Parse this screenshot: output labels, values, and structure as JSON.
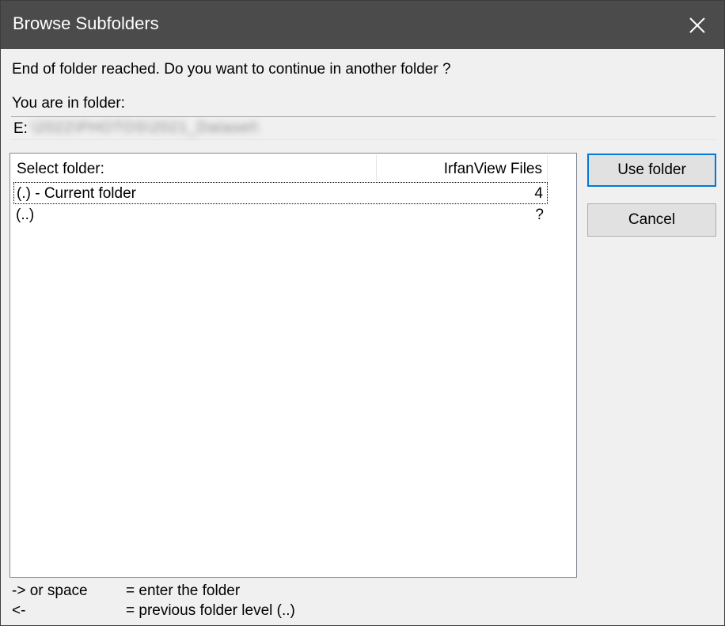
{
  "window": {
    "title": "Browse Subfolders"
  },
  "message": "End of folder reached. Do you want to continue in another folder ?",
  "current_folder": {
    "label": "You are in folder:",
    "path_prefix": "E:",
    "path_obscured": "\\2022\\PHOTOS\\2021_Dataset\\"
  },
  "folder_list": {
    "columns": [
      "Select folder:",
      "IrfanView Files"
    ],
    "rows": [
      {
        "name": "(.) - Current folder",
        "count": "4"
      },
      {
        "name": "(..)",
        "count": "?"
      }
    ]
  },
  "buttons": {
    "use_folder": "Use folder",
    "cancel": "Cancel"
  },
  "hints": [
    {
      "key": "-> or space",
      "action": "= enter the folder"
    },
    {
      "key": "<-",
      "action": "= previous folder level (..)"
    }
  ],
  "icons": {
    "close": "close-icon"
  },
  "colors": {
    "titlebar": "#4b4b4b",
    "background": "#f0f0f0",
    "default_button_border": "#0078d7"
  }
}
